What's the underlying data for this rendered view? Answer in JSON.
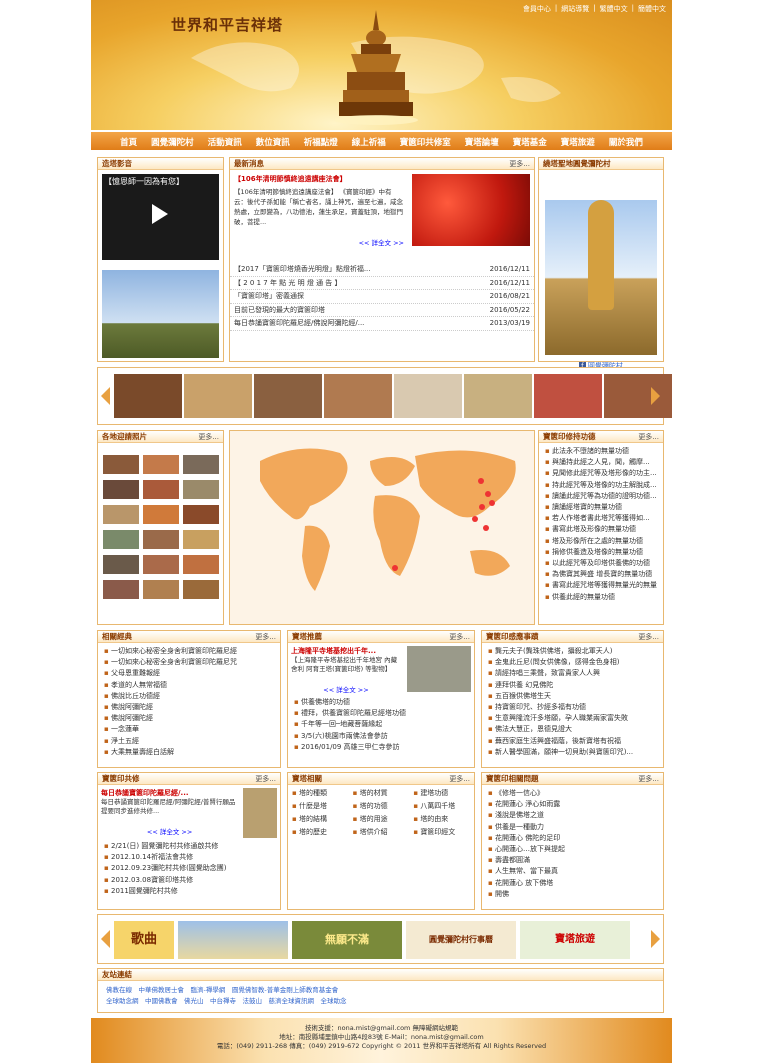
{
  "header": {
    "title": "世界和平吉祥塔",
    "toplinks": [
      "會員中心",
      "網站導覽",
      "繁體中文",
      "簡體中文"
    ]
  },
  "nav": [
    "首頁",
    "圓覺彌陀村",
    "活動資訊",
    "數位資訊",
    "祈福點燈",
    "線上祈福",
    "寶篋印共修室",
    "寶塔論壇",
    "寶塔基金",
    "寶塔旅遊",
    "關於我們"
  ],
  "video": {
    "title": "造塔影音",
    "caption": "【憶恩師一因為有您】"
  },
  "news": {
    "title": "最新消息",
    "more": "更多...",
    "headline": "【106年清明節慎終追遠講座法會】",
    "text": "【106年清明節慎終追遠講座法會】 《寶篋印經》中有云：後代子孫如能「稱亡者名，誦上神咒，遍至七遍，咸念熱處，立即變為，八功德池，蓮生承足，寶蓋駐頂，地獄門破，菩提...",
    "readmore": "<< 詳全文 >>",
    "items": [
      {
        "t": "【2017「寶篋印塔燒香光明燈」點燈祈福...",
        "d": "2016/12/11"
      },
      {
        "t": "【 2 0 1 7 年 點 光 明 燈 通 告 】",
        "d": "2016/12/11"
      },
      {
        "t": "「寶篋印塔」密義通探",
        "d": "2016/08/21"
      },
      {
        "t": "目前已發現的最大的寶篋印塔",
        "d": "2016/05/22"
      },
      {
        "t": "每日恭誦寶篋印陀羅尼經/佛說阿彌陀經/...",
        "d": "2013/03/19"
      }
    ]
  },
  "village": {
    "title": "繞塔聖地圓覺彌陀村",
    "fb": "圓覺彌陀村"
  },
  "photos": {
    "title": "各地迎請照片",
    "more": "更多..."
  },
  "merit": {
    "title": "寶篋印修持功德",
    "more": "更多...",
    "items": [
      "此法永不墮諸的無量功德",
      "與誦持此經之人見，聞，觸摩...",
      "見聞修此經咒等及塔形像的功主...",
      "持此經咒等及塔像的功主解脫成...",
      "讀誦此經咒等為功德的證明功德...",
      "讀誦經塔寶的無量功德",
      "若人作塔者書此塔咒等獲得如...",
      "書寫此塔及形像的無量功德",
      "塔及形像所在之處的無量功德",
      "捐修供養造及塔像的無量功德",
      "以此經咒等及印塔供養佛的功德",
      "為佛寶其興盛 增長寶的無量功德",
      "書寫此經咒塔等獲得無量光的無量功德",
      "供養此經的無量功德"
    ]
  },
  "sutra": {
    "title": "相關經典",
    "more": "更多...",
    "items": [
      "一切如來心秘密全身舍利寶篋印陀羅尼經",
      "一切如來心秘密全身舍利寶篋印陀羅尼咒",
      "父母恩重難報經",
      "孝道的人無常福德",
      "佛說比丘功德經",
      "佛說阿彌陀經",
      "佛說阿彌陀經",
      "一念蓮華",
      "淨土五經",
      "大乘無量壽經白話解"
    ]
  },
  "recommend": {
    "title": "寶塔推薦",
    "more": "更多...",
    "headline": "上海隆平寺塔基挖出千年...",
    "text": "【上海隆平寺塔基挖出千年地宮 內藏 舍利 阿育王塔(寶篋印塔) 等聖物】",
    "readmore": "<< 詳全文 >>",
    "items": [
      "供養佛塔的功德",
      "禮拜，供養寶篋印陀羅尼經塔功德",
      "千年等一回─地藏菩薩緣起",
      "3/5(六)桃園市兩佛法會參訪",
      "2016/01/09 高雄三甲仁寺參訪"
    ]
  },
  "qa": {
    "title": "寶篋印感應事蹟",
    "more": "更多...",
    "items": [
      "龔元夫子(龔珠供佛塔，攝殺北軍天人)",
      "金鬼此丘尼(問女供佛像，感得金色身相)",
      "請經持唱三乘聲，致富貴家人人興",
      "連拜供養 幻見佛陀",
      "五百猴供佛塔生天",
      "持寶篋印咒、抄經多福有功德",
      "生意興隆流汗多塔願，孕人職業兩家富失敗",
      "佛法大慧正，恩德見證大",
      "蕪西家庭生活興盛福蔭，後新寶塔有祝福",
      "新人醫學圓滿，願神一切貝助(與寶篋印咒)..."
    ]
  },
  "gongxiu": {
    "title": "寶篋印共修",
    "more": "更多...",
    "headline": "每日恭誦寶篋印陀羅尼經/...",
    "text": "每日恭誦寶篋印陀羅尼經/阿彌陀經/普賢行願品提要同步進修共修...",
    "readmore": "<< 詳全文 >>",
    "items": [
      "2/21(日) 圓覺彌陀村共修通啟共修",
      "2012.10.14祈福法會共修",
      "2012.09.23彌陀村共修(圓覺助念團)",
      "2012.03.08寶篋印塔共修",
      "2011圓覺彌陀村共修"
    ]
  },
  "pics": {
    "title": "寶塔相關",
    "more": "更多...",
    "items": [
      "塔的種類",
      "塔的材質",
      "建塔功德",
      "什麼是塔",
      "塔的功德",
      "八萬四千塔",
      "塔的結構",
      "塔的用途",
      "塔的由來",
      "塔的歷史",
      "塔供介紹",
      "寶篋印經文"
    ]
  },
  "related": {
    "title": "寶篋印相關問題",
    "more": "更多...",
    "items": [
      "《修塔一信心》",
      "花開蓮心 淨心如雨露",
      "淺說是佛塔之道",
      "供養是一種動力",
      "花開蓮心 佛陀的足印",
      "心開蓮心…放下與提起",
      "壽盡都圓滿",
      "人生無常、當下最真",
      "花開蓮心 放下佛塔",
      "開佛"
    ]
  },
  "banners": {
    "b1": "歌曲",
    "b2": "無願不滿",
    "b3": "圓覺彌陀村行事曆",
    "b4": "寶塔旅遊",
    "b5": "寶篋印共修室"
  },
  "links": {
    "title": "友站連結",
    "items": [
      "佛教在線",
      "中華佛教居士會",
      "臨濟-禪學網",
      "圓覺佛智教-普華金剛上師教育基金會",
      "全球助念網",
      "中國佛教會",
      "佛光山",
      "中台禪寺",
      "法鼓山",
      "慈濟全球資訊網",
      "全球助念"
    ]
  },
  "footer": {
    "line1": "技術支援：nona.mist@gmail.com 無障礙網站規範",
    "line2": "地址：南投縣埔里鎮中山路4段83號 E-Mail：nona.mist@gmail.com",
    "line3": "電話：(049) 2911-268 傳真：(049) 2919-672 Copyright © 2011 世界和平吉祥塔所有 All Rights Reserved"
  }
}
